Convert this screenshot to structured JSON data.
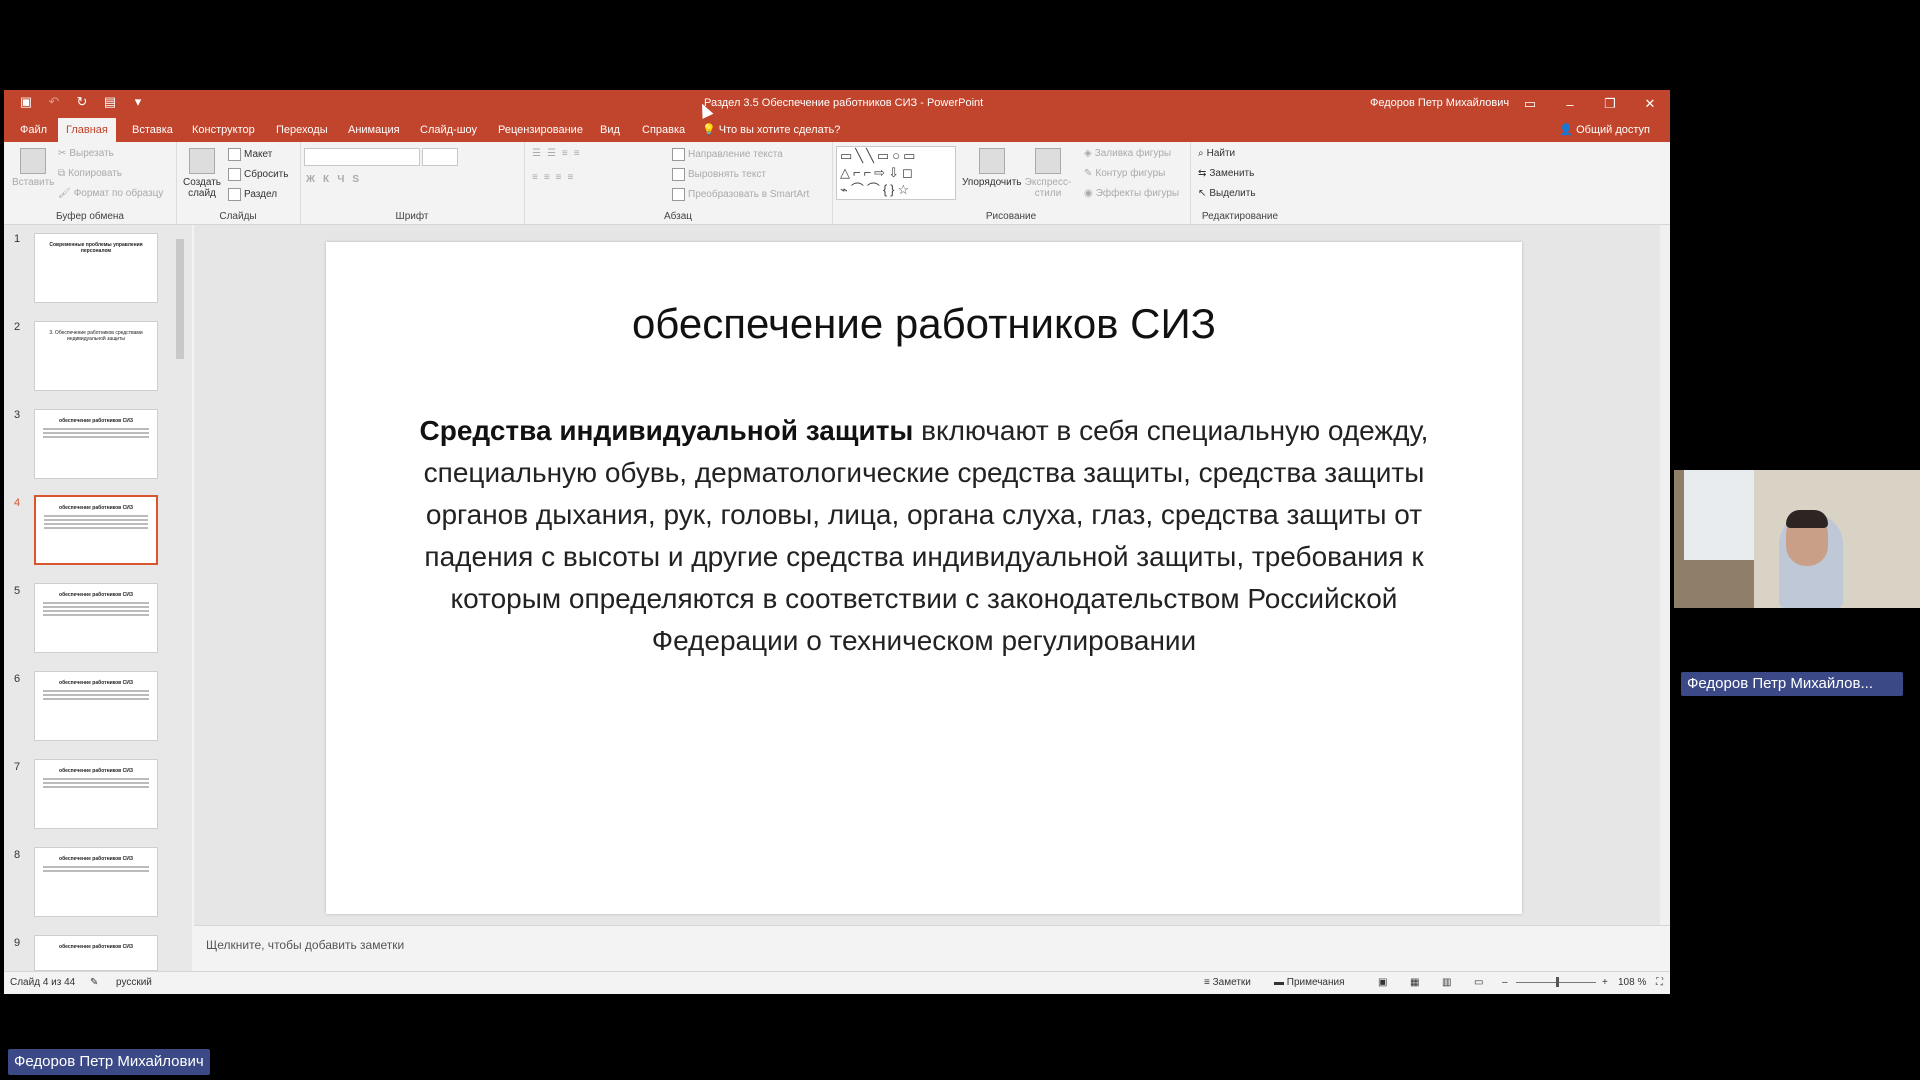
{
  "window": {
    "title": "Раздел 3.5 Обеспечение работников СИЗ - PowerPoint",
    "user": "Федоров Петр Михайлович",
    "controls": [
      "ribbon-display-icon",
      "minimize-icon",
      "restore-icon",
      "close-icon"
    ]
  },
  "tabs": [
    "Файл",
    "Главная",
    "Вставка",
    "Конструктор",
    "Переходы",
    "Анимация",
    "Слайд-шоу",
    "Рецензирование",
    "Вид",
    "Справка"
  ],
  "tell_me": "Что вы хотите сделать?",
  "share": "Общий доступ",
  "ribbon": {
    "clipboard": {
      "label": "Буфер обмена",
      "paste": "Вставить",
      "cut": "Вырезать",
      "copy": "Копировать",
      "format": "Формат по образцу"
    },
    "slides": {
      "label": "Слайды",
      "new": "Создать слайд",
      "layout": "Макет",
      "reset": "Сбросить",
      "section": "Раздел"
    },
    "font": {
      "label": "Шрифт"
    },
    "paragraph": {
      "label": "Абзац",
      "direction": "Направление текста",
      "align": "Выровнять текст",
      "smartart": "Преобразовать в SmartArt"
    },
    "drawing": {
      "label": "Рисование",
      "arrange": "Упорядочить",
      "styles": "Экспресс-стили",
      "fill": "Заливка фигуры",
      "outline": "Контур фигуры",
      "effects": "Эффекты фигуры"
    },
    "editing": {
      "label": "Редактирование",
      "find": "Найти",
      "replace": "Заменить",
      "select": "Выделить"
    }
  },
  "thumbnails": [
    {
      "num": "1",
      "title": "Современные проблемы управления персоналом"
    },
    {
      "num": "2",
      "title": "3. Обеспечение работников средствами индивидуальной защиты"
    },
    {
      "num": "3",
      "title": "обеспечение работников СИЗ"
    },
    {
      "num": "4",
      "title": "обеспечение работников СИЗ"
    },
    {
      "num": "5",
      "title": "обеспечение работников СИЗ"
    },
    {
      "num": "6",
      "title": "обеспечение работников СИЗ"
    },
    {
      "num": "7",
      "title": "обеспечение работников СИЗ"
    },
    {
      "num": "8",
      "title": "обеспечение работников СИЗ"
    },
    {
      "num": "9",
      "title": "обеспечение работников СИЗ"
    }
  ],
  "slide": {
    "title": "обеспечение работников СИЗ",
    "bold_lead": "Средства индивидуальной защиты",
    "body": " включают в себя специальную одежду, специальную обувь, дерматологические средства защиты, средства защиты органов дыхания, рук, головы, лица, органа слуха, глаз, средства защиты от падения с высоты и другие средства индивидуальной защиты, требования к которым определяются в соответствии с законодательством Российской Федерации о техническом регулировании"
  },
  "notes_placeholder": "Щелкните, чтобы добавить заметки",
  "status": {
    "slide_counter": "Слайд 4 из 44",
    "language": "русский",
    "notes": "Заметки",
    "comments": "Примечания",
    "zoom": "108 %"
  },
  "participant": {
    "name_short": "Федоров Петр Михайлов...",
    "name_full": "Федоров Петр Михайлович"
  }
}
